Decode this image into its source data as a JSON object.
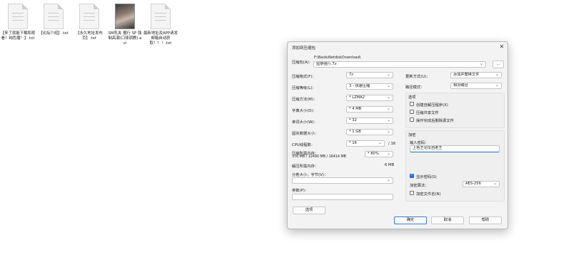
{
  "desktop": {
    "icons": [
      {
        "label": "【来了就能下载和观看！纯色播！】.txt",
        "type": "text"
      },
      {
        "label": "【论坛介绍】.txt",
        "type": "text"
      },
      {
        "label": "【永久地址发布页】.txt",
        "type": "text"
      },
      {
        "label": "SM乳夹 捆行 SP 强制高潮(口球调教).avi",
        "type": "video"
      },
      {
        "label": "最新地址及APP请发邮箱自动获取！！！.txt",
        "type": "text"
      }
    ]
  },
  "dialog": {
    "title": "添加到压缩包",
    "close": "✕",
    "archive_label": "压缩包(A)：",
    "archive_path": "F:\\BaiduNetdiskDownload\\",
    "archive_name": "监禁强行.7z",
    "browse_label": "...",
    "format_label": "压缩格式(F)：",
    "format_value": "7z",
    "level_label": "压缩等级(L)：",
    "level_value": "3 - 快速压缩",
    "method_label": "压缩方法(M)：",
    "method_value": "* LZMA2",
    "dict_label": "字典大小(D)：",
    "dict_value": "* 4 MB",
    "word_label": "单词大小(W)：",
    "word_value": "* 32",
    "solid_label": "固实数据大小：",
    "solid_value": "* 1 GB",
    "cpu_label": "CPU线程数：",
    "cpu_value": "* 16",
    "cpu_total": "/ 16",
    "mem_label": "压缩所需内存：",
    "mem_detail": "376 MB / 12490 MB / 16414 MB",
    "mem_percent": "* 80%",
    "unmem_label": "解压所需内存：",
    "unmem_value": "6 MB",
    "split_label": "分卷大小，字节(V)：",
    "params_label": "参数(P)：",
    "options_button": "选项",
    "update_label": "更新方式(U)：",
    "update_value": "添加并替换文件",
    "pathmode_label": "路径模式：",
    "pathmode_value": "相对路径",
    "options_group": "选项",
    "opt_sfx": "创建自解压程序(X)",
    "opt_shared": "压缩共享文件",
    "opt_delete": "操作完成后删除源文件",
    "encrypt_group": "加密",
    "pw_label": "输入密码：",
    "pw_value": "上色王论坛自老王",
    "show_pw": "显示密码(S)",
    "enc_method_label": "加密算法：",
    "enc_method_value": "AES-256",
    "enc_names": "加密文件名(N)",
    "ok": "确定",
    "cancel": "取消",
    "help": "帮助"
  }
}
